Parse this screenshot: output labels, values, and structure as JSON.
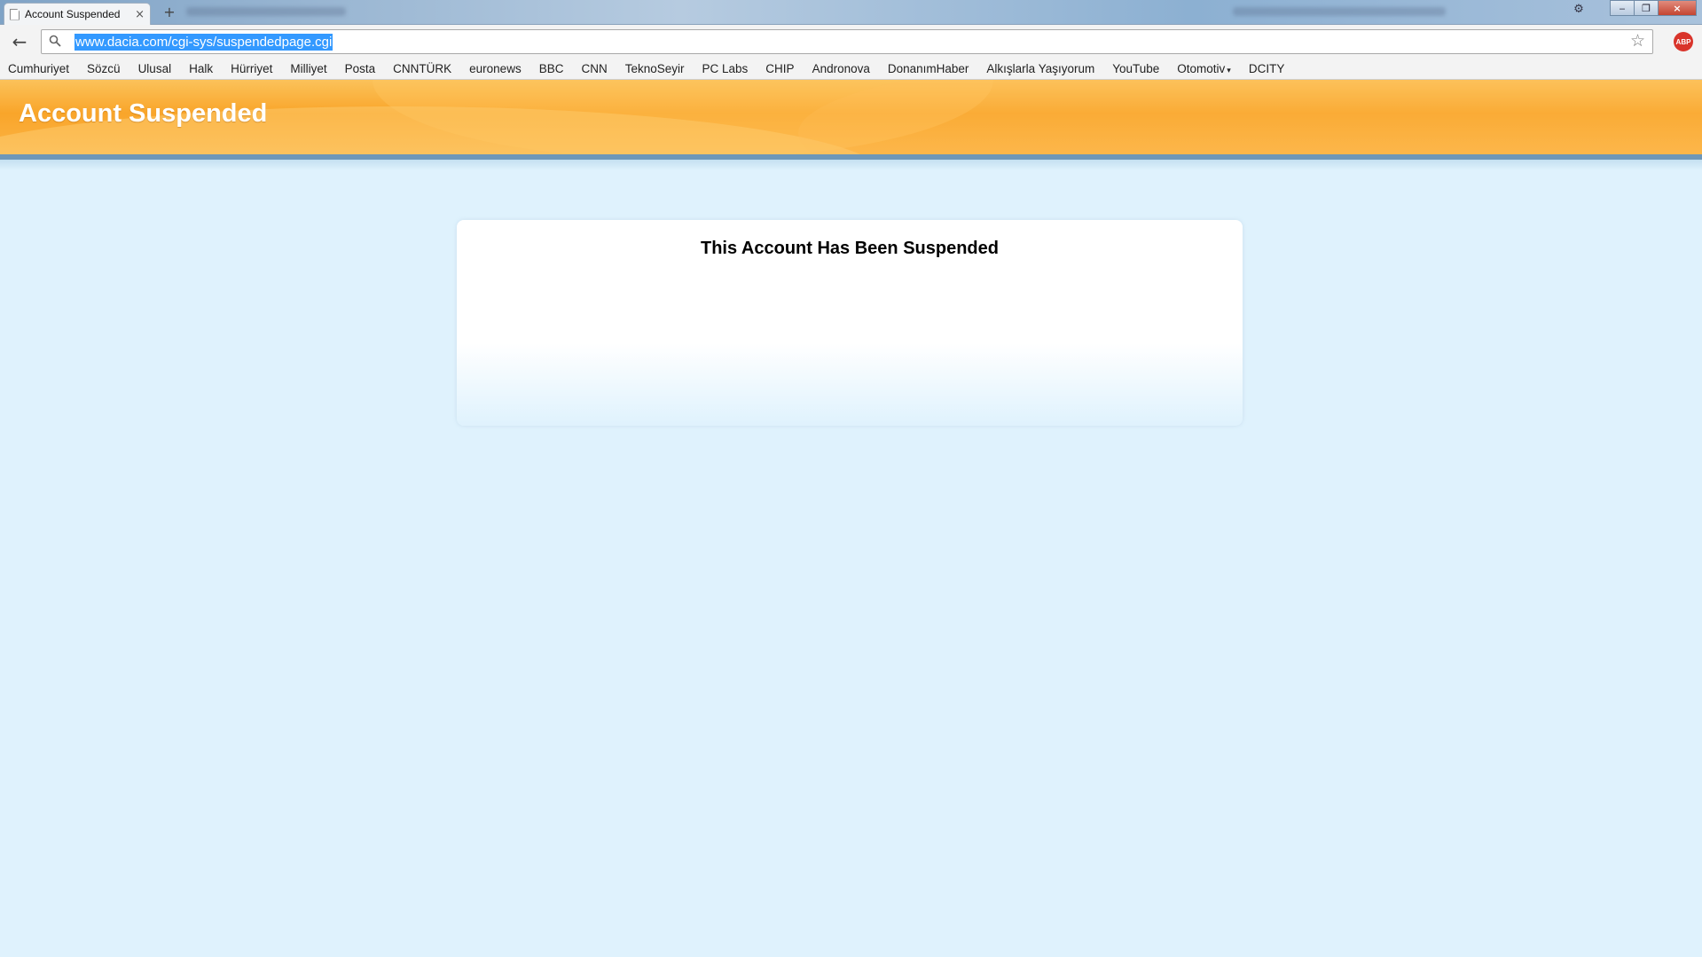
{
  "browser": {
    "tab": {
      "title": "Account Suspended",
      "close_glyph": "×"
    },
    "newtab_glyph": "+",
    "window_controls": {
      "minimize": "‒",
      "maximize": "❐",
      "close": "×",
      "settings_icon": "gear-icon"
    },
    "toolbar": {
      "back_glyph": "←",
      "url": "www.dacia.com/cgi-sys/suspendedpage.cgi",
      "star_glyph": "☆",
      "extension_label": "ABP"
    },
    "bookmarks": [
      {
        "label": "Cumhuriyet"
      },
      {
        "label": "Sözcü"
      },
      {
        "label": "Ulusal"
      },
      {
        "label": "Halk"
      },
      {
        "label": "Hürriyet"
      },
      {
        "label": "Milliyet"
      },
      {
        "label": "Posta"
      },
      {
        "label": "CNNTÜRK"
      },
      {
        "label": "euronews"
      },
      {
        "label": "BBC"
      },
      {
        "label": "CNN"
      },
      {
        "label": "TeknoSeyir"
      },
      {
        "label": "PC Labs"
      },
      {
        "label": "CHIP"
      },
      {
        "label": "Andronova"
      },
      {
        "label": "DonanımHaber"
      },
      {
        "label": "Alkışlarla Yaşıyorum"
      },
      {
        "label": "YouTube"
      },
      {
        "label": "Otomotiv",
        "caret": "▾"
      },
      {
        "label": "DCITY"
      }
    ]
  },
  "page": {
    "header_title": "Account Suspended",
    "card_title": "This Account Has Been Suspended"
  },
  "colors": {
    "header_orange": "#f9a52a",
    "header_bar": "#6e97b8",
    "page_background": "#dff2fd",
    "url_selection": "#3399ff",
    "abp_red": "#d9342b"
  }
}
